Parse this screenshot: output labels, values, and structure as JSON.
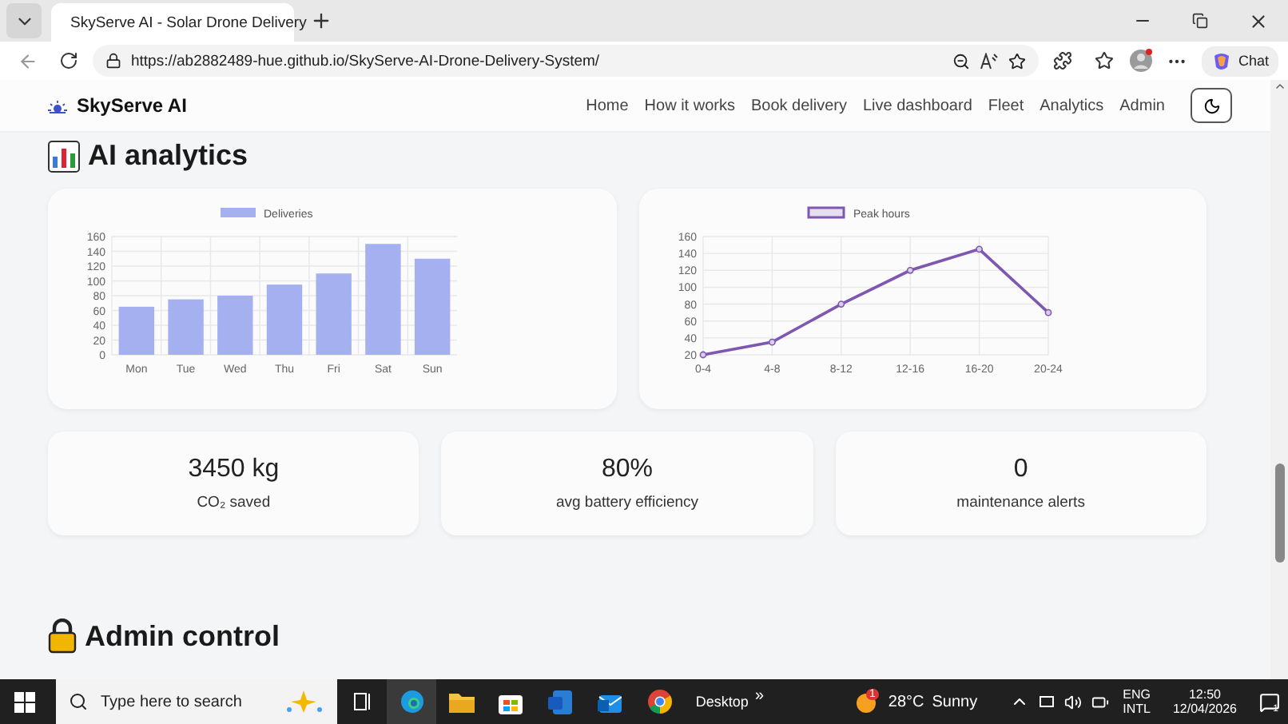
{
  "browser": {
    "tab_title": "SkyServe AI - Solar Drone Delivery",
    "url": "https://ab2882489-hue.github.io/SkyServe-AI-Drone-Delivery-System/",
    "chat_label": "Chat"
  },
  "navbar": {
    "brand": "SkyServe AI",
    "links": [
      {
        "label": "Home"
      },
      {
        "label": "How it works"
      },
      {
        "label": "Book delivery"
      },
      {
        "label": "Live dashboard"
      },
      {
        "label": "Fleet"
      },
      {
        "label": "Analytics"
      },
      {
        "label": "Admin"
      }
    ]
  },
  "analytics": {
    "heading": "AI analytics",
    "charts": [
      {
        "chart_data": {
          "type": "bar",
          "categories": [
            "Mon",
            "Tue",
            "Wed",
            "Thu",
            "Fri",
            "Sat",
            "Sun"
          ],
          "series": [
            {
              "name": "Deliveries",
              "color": "#a5b0f0",
              "values": [
                65,
                75,
                80,
                95,
                110,
                150,
                130
              ]
            }
          ],
          "ylim": [
            0,
            160
          ],
          "yticks": [
            0,
            20,
            40,
            60,
            80,
            100,
            120,
            140,
            160
          ],
          "grid": true
        }
      },
      {
        "chart_data": {
          "type": "line",
          "categories": [
            "0-4",
            "4-8",
            "8-12",
            "12-16",
            "16-20",
            "20-24"
          ],
          "series": [
            {
              "name": "Peak hours",
              "color": "#7e57b0",
              "values": [
                20,
                35,
                80,
                120,
                145,
                70
              ],
              "marker": true
            }
          ],
          "ylim": [
            20,
            160
          ],
          "yticks": [
            20,
            40,
            60,
            80,
            100,
            120,
            140,
            160
          ],
          "grid": true
        }
      }
    ],
    "stats": [
      {
        "value": "3450 kg",
        "label": "CO₂ saved"
      },
      {
        "value": "80%",
        "label": "avg battery efficiency"
      },
      {
        "value": "0",
        "label": "maintenance alerts"
      }
    ]
  },
  "admin": {
    "heading": "Admin control"
  },
  "taskbar": {
    "search_placeholder": "Type here to search",
    "desktop_label": "Desktop",
    "desktop_more": "»",
    "temperature": "28°C",
    "weather": "Sunny",
    "weather_badge": "1",
    "language": "ENG",
    "layout": "INTL",
    "time": "12:50",
    "date": "12/04/2026",
    "notification_count": "1"
  }
}
